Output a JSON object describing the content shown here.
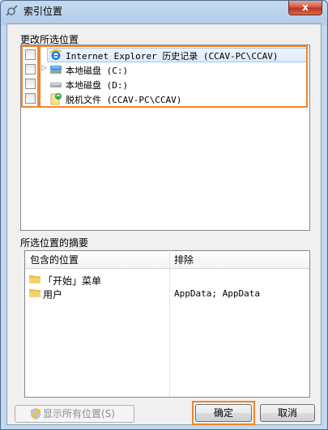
{
  "window": {
    "title": "索引位置",
    "close_label": "x"
  },
  "change_section": {
    "label": "更改所选位置",
    "items": [
      {
        "label": "Internet Explorer 历史记录 (CCAV-PC\\CCAV)",
        "icon": "ie-icon",
        "expandable": false
      },
      {
        "label": "本地磁盘 (C:)",
        "icon": "hard-drive-icon",
        "expandable": true
      },
      {
        "label": "本地磁盘 (D:)",
        "icon": "hard-drive-icon",
        "expandable": false
      },
      {
        "label": "脱机文件 (CCAV-PC\\CCAV)",
        "icon": "offline-files-icon",
        "expandable": false
      }
    ]
  },
  "summary_section": {
    "label": "所选位置的摘要",
    "columns": {
      "included": "包含的位置",
      "excluded": "排除"
    },
    "rows": [
      {
        "included": "「开始」菜单",
        "excluded": ""
      },
      {
        "included": "用户",
        "excluded": "AppData; AppData"
      }
    ]
  },
  "buttons": {
    "show_all": "显示所有位置(S)",
    "ok": "确定",
    "cancel": "取消"
  },
  "colors": {
    "highlight_box": "#f0852d",
    "title_bar": "#b3cbe6"
  }
}
